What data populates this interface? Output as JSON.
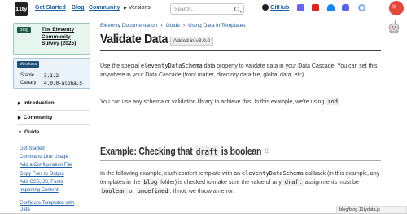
{
  "header": {
    "logo_text": "11ty",
    "nav": [
      "Get Started",
      "Blog",
      "Community"
    ],
    "versions_label": "Versions",
    "search_placeholder": "Search...",
    "github_label": "GitHub",
    "social_icons": [
      "mastodon-icon",
      "youtube-icon",
      "bluesky-icon",
      "discord-icon",
      "opencollective-icon"
    ],
    "colors": {
      "link": "#1a5fa8",
      "mastodon": "#6364ff",
      "youtube": "#e62117",
      "bluesky": "#1185fe",
      "discord": "#5865f2",
      "opencollective": "#7fadf2"
    }
  },
  "sidebar": {
    "banner": {
      "tag": "Blog",
      "title": "The Eleventy Community Survey (2025)"
    },
    "versions": {
      "tag": "Versions",
      "stable_label": "Stable",
      "stable_value": "3.1.2",
      "canary_label": "Canary",
      "canary_value": "4.0.0-alpha.5"
    },
    "sections": [
      {
        "label": "Introduction",
        "expanded": false
      },
      {
        "label": "Community",
        "expanded": false
      },
      {
        "label": "Guide",
        "expanded": true
      }
    ],
    "guide_links": [
      "Get Started",
      "Command Line Usage",
      "Add a Configuration File",
      "Copy Files to Output",
      "Add CSS, JS, Fonts",
      "Importing Content",
      "Configure Templates with",
      "Data"
    ]
  },
  "main": {
    "breadcrumbs": [
      "Eleventy Documentation",
      "Guide",
      "Using Data in Templates"
    ],
    "title": "Validate Data",
    "added_badge": "Added in v3.0.0",
    "p1": {
      "before": "Use the special ",
      "code": "eleventyDataSchema",
      "after": " data property to validate data in your Data Cascade. You can set this anywhere in your Data Cascade (front matter, directory data file, global data, etc)."
    },
    "p2": {
      "before": "You can use any schema or validation library to achieve this. In this example, we're using ",
      "code": "zod",
      "after": "."
    },
    "h2": {
      "before": "Example: Checking that ",
      "code": "draft",
      "after": " is boolean",
      "hash": "#"
    },
    "p3": {
      "t1": "In the following example, each content template with an ",
      "c1": "eleventyDataSchema",
      "t2": " callback (in this example, any templates in the ",
      "c2": "blog",
      "t3": " folder) is checked to make sure the value of any ",
      "c3": "draft",
      "t4": " assignments must be ",
      "c4": "boolean",
      "t5": " or ",
      "c5": "undefined",
      "t6": ". If not, we throw an error."
    }
  },
  "status_url": "blog/blog.11tydata.js"
}
